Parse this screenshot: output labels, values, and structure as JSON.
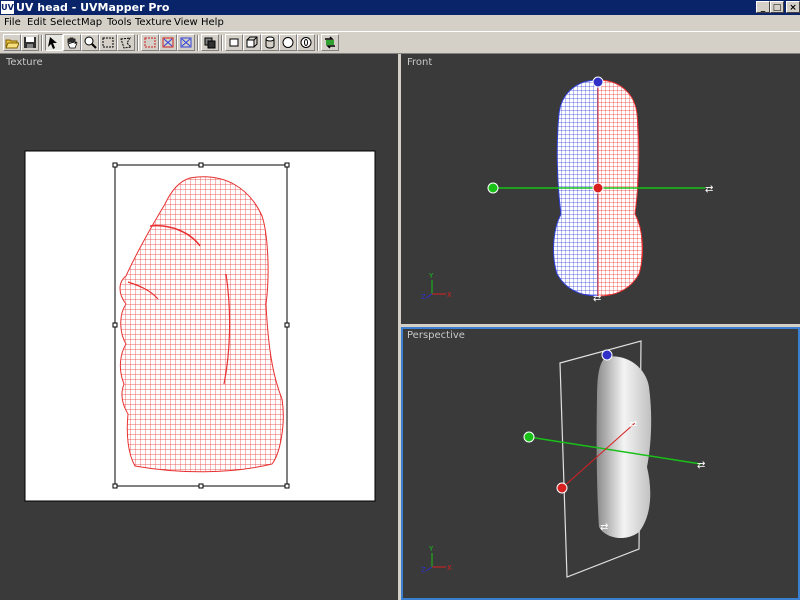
{
  "window": {
    "title": "UV head - UVMapper Pro",
    "icon_text": "UV",
    "controls": [
      "minimize",
      "maximize",
      "close"
    ],
    "control_glyphs": {
      "minimize": "_",
      "maximize": "□",
      "close": "×"
    }
  },
  "menu": {
    "items": [
      {
        "label": "File",
        "name": "menu-file"
      },
      {
        "label": "Edit",
        "name": "menu-edit"
      },
      {
        "label": "Select",
        "name": "menu-select"
      },
      {
        "label": "Map",
        "name": "menu-map"
      },
      {
        "label": "Tools",
        "name": "menu-tools"
      },
      {
        "label": "Texture",
        "name": "menu-texture"
      },
      {
        "label": "View",
        "name": "menu-view"
      },
      {
        "label": "Help",
        "name": "menu-help"
      }
    ]
  },
  "toolbar": {
    "buttons": [
      "open-icon",
      "save-icon",
      "select-arrow-icon",
      "pan-hand-icon",
      "zoom-icon",
      "marquee-select-icon",
      "lasso-select-icon",
      "select-none-icon",
      "select-invert-icon",
      "select-all-icon",
      "front-view-icon",
      "box-primitive-icon",
      "cube-primitive-icon",
      "cylinder-primitive-icon",
      "sphere-primitive-icon",
      "torus-primitive-icon",
      "apply-map-icon"
    ],
    "pressed": "select-arrow-icon"
  },
  "panes": {
    "texture": {
      "label": "Texture"
    },
    "front": {
      "label": "Front"
    },
    "perspective": {
      "label": "Perspective"
    }
  },
  "colors": {
    "viewport_bg": "#3a3a3a",
    "wire_red": "#e83030",
    "wire_blue": "#3040d8",
    "axis_green": "#18c018",
    "axis_red": "#d82020",
    "axis_blue": "#3030c8",
    "active_pane_border": "#3a7fd0"
  },
  "axis_gizmo_labels": {
    "x": "X",
    "y": "Y",
    "z": "Z"
  }
}
